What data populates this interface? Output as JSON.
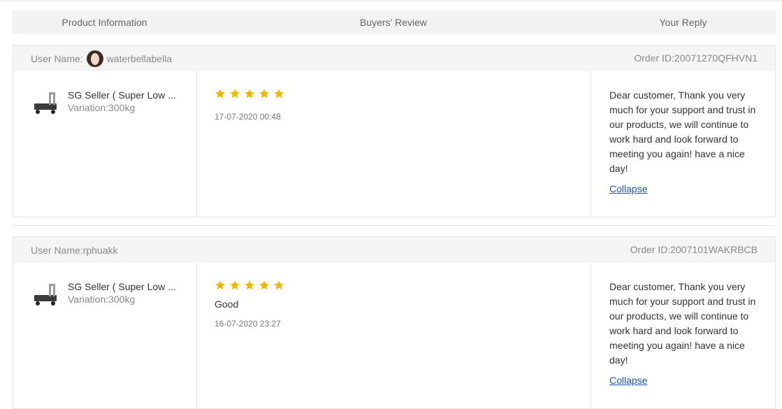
{
  "header": {
    "product_col": "Product Information",
    "review_col": "Buyers' Review",
    "reply_col": "Your Reply"
  },
  "reviews": [
    {
      "user_label": "User Name:",
      "user_name": "waterbellabella",
      "order_label": "Order ID:",
      "order_id": "20071270QFHVN1",
      "product_name": "SG Seller ( Super Low ...",
      "variation": "Variation:300kg",
      "rating": 5,
      "comment": "",
      "date": "17-07-2020 00:48",
      "reply": "Dear customer, Thank you very much for your support and trust in our products, we will continue to work hard and look forward to meeting you again! have a nice day!",
      "collapse_label": "Collapse"
    },
    {
      "user_label": "User Name:",
      "user_name": "rphuakk",
      "order_label": "Order ID:",
      "order_id": "2007101WAKRBCB",
      "product_name": "SG Seller ( Super Low ...",
      "variation": "Variation:300kg",
      "rating": 5,
      "comment": "Good",
      "date": "16-07-2020 23:27",
      "reply": "Dear customer, Thank you very much for your support and trust in our products, we will continue to work hard and look forward to meeting you again! have a nice day!",
      "collapse_label": "Collapse"
    }
  ],
  "icons": {
    "star": "star-icon",
    "product": "platform-trolley-icon",
    "avatar": "user-avatar"
  },
  "colors": {
    "star": "#f5b400",
    "link": "#1a56c4",
    "header_bg": "#f2f2f2"
  }
}
